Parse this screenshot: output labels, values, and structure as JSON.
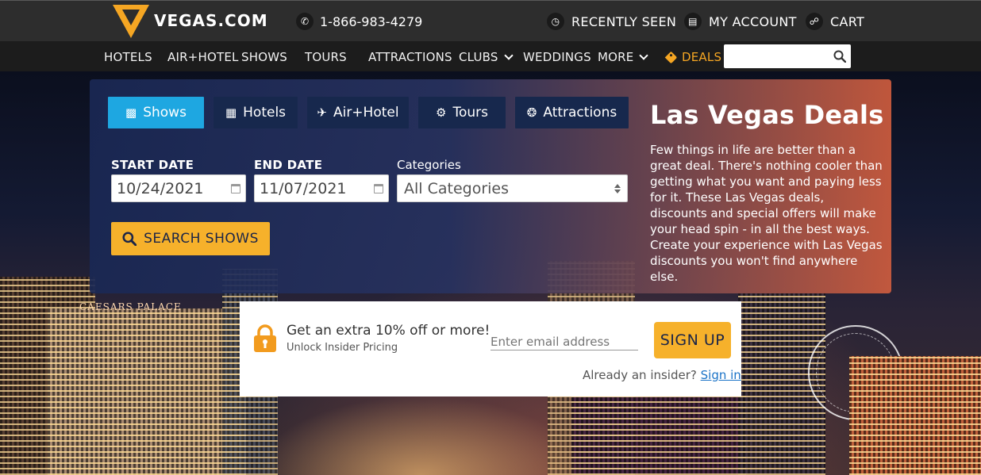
{
  "header": {
    "logo_text": "VEGAS.COM",
    "phone": "1-866-983-4279",
    "recently_seen": "RECENTLY SEEN",
    "my_account": "MY ACCOUNT",
    "cart": "CART"
  },
  "nav": {
    "items": [
      "HOTELS",
      "AIR+HOTEL",
      "SHOWS",
      "TOURS",
      "ATTRACTIONS",
      "CLUBS",
      "WEDDINGS",
      "MORE",
      "DEALS"
    ],
    "search_placeholder": ""
  },
  "search_panel": {
    "tabs": [
      "Shows",
      "Hotels",
      "Air+Hotel",
      "Tours",
      "Attractions"
    ],
    "active_tab": "Shows",
    "start_date_label": "START DATE",
    "start_date_value": "10/24/2021",
    "end_date_label": "END DATE",
    "end_date_value": "11/07/2021",
    "categories_label": "Categories",
    "categories_value": "All Categories",
    "search_button": "SEARCH SHOWS"
  },
  "deals": {
    "title": "Las Vegas Deals",
    "description": "Few things in life are better than a great deal. There's nothing cooler than getting what you want and paying less for it. These Las Vegas deals, discounts and special offers will make your head spin - in all the best ways. Create your experience with Las Vegas discounts you won't find anywhere else."
  },
  "insider": {
    "title": "Get an extra 10% off or more!",
    "subtitle": "Unlock Insider Pricing",
    "email_placeholder": "Enter email address",
    "signup_button": "SIGN UP",
    "already_text": "Already an insider?",
    "signin_link": "Sign in"
  },
  "hero": {
    "sign_text": "CAESARS PALACE"
  },
  "colors": {
    "accent_yellow": "#f6b12b",
    "tab_active": "#1ea7e1",
    "tab_inactive": "#17284d",
    "deals_orange": "#f5a623"
  }
}
